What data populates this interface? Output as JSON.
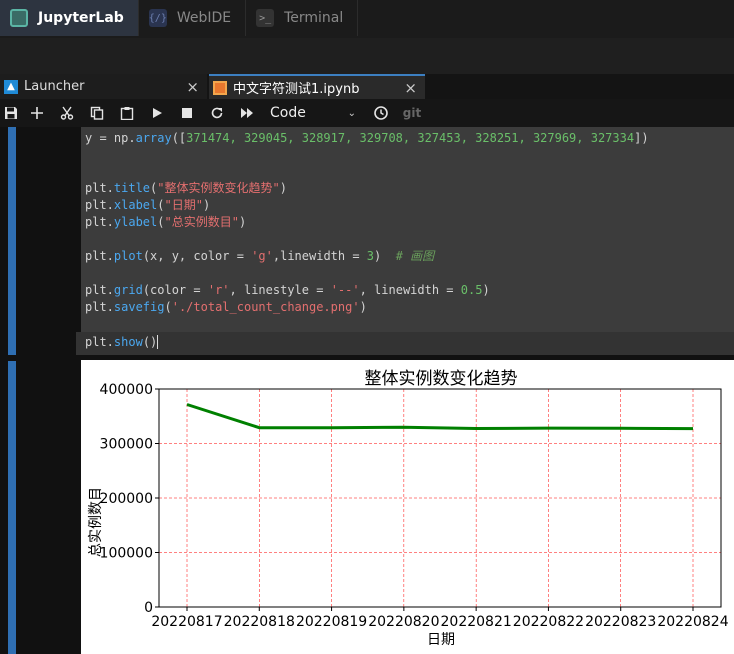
{
  "top_tabs": [
    {
      "label": "JupyterLab",
      "icon": "jupyterlab-logo-icon",
      "active": true
    },
    {
      "label": "WebIDE",
      "icon": "webide-logo-icon",
      "active": false
    },
    {
      "label": "Terminal",
      "icon": "terminal-icon",
      "active": false
    }
  ],
  "doc_tabs": [
    {
      "label": "Launcher",
      "icon": "launcher-icon",
      "close": "×"
    },
    {
      "label": "中文字符测试1.ipynb",
      "icon": "notebook-icon",
      "close": "×"
    }
  ],
  "toolbar": {
    "items": [
      "save-icon",
      "add-icon",
      "cut-icon",
      "copy-icon",
      "paste-icon",
      "run-icon",
      "stop-icon",
      "restart-icon",
      "fast-forward-icon"
    ],
    "cell_type": "Code",
    "clock": "clock-icon",
    "git_label": "git"
  },
  "code": {
    "line1_prefix": "y = np.",
    "line1_fn": "array",
    "line1_rest_open": "([",
    "line1_numbers": "371474, 329045, 328917, 329708, 327453, 328251, 327969, 327334",
    "line1_close": "])",
    "title_fn": "title",
    "title_str": "\"整体实例数变化趋势\"",
    "xlabel_fn": "xlabel",
    "xlabel_str": "\"日期\"",
    "ylabel_fn": "ylabel",
    "ylabel_str": "\"总实例数目\"",
    "plot_fn": "plot",
    "plot_args_a": "(x, y, color = ",
    "plot_color": "'g'",
    "plot_args_b": ",linewidth = ",
    "plot_lw": "3",
    "plot_close": ")",
    "plot_comment": "# 画图",
    "grid_fn": "grid",
    "grid_a": "(color = ",
    "grid_color": "'r'",
    "grid_b": ", linestyle = ",
    "grid_ls": "'--'",
    "grid_c": ", linewidth = ",
    "grid_lw": "0.5",
    "grid_close": ")",
    "savefig_fn": "savefig",
    "savefig_str": "'./total_count_change.png'",
    "show_fn": "show",
    "show_args": "()"
  },
  "chart_data": {
    "type": "line",
    "title": "整体实例数变化趋势",
    "xlabel": "日期",
    "ylabel": "总实例数目",
    "categories": [
      "20220817",
      "20220818",
      "20220819",
      "20220820",
      "20220821",
      "20220822",
      "20220823",
      "20220824"
    ],
    "values": [
      371474,
      329045,
      328917,
      329708,
      327453,
      328251,
      327969,
      327334
    ],
    "ylim": [
      0,
      400000
    ],
    "yticks": [
      0,
      100000,
      200000,
      300000,
      400000
    ],
    "ytick_labels": [
      "0",
      "100000",
      "200000",
      "300000",
      "400000"
    ],
    "line_color": "#008000",
    "grid_color": "#ff0000",
    "grid": true
  }
}
